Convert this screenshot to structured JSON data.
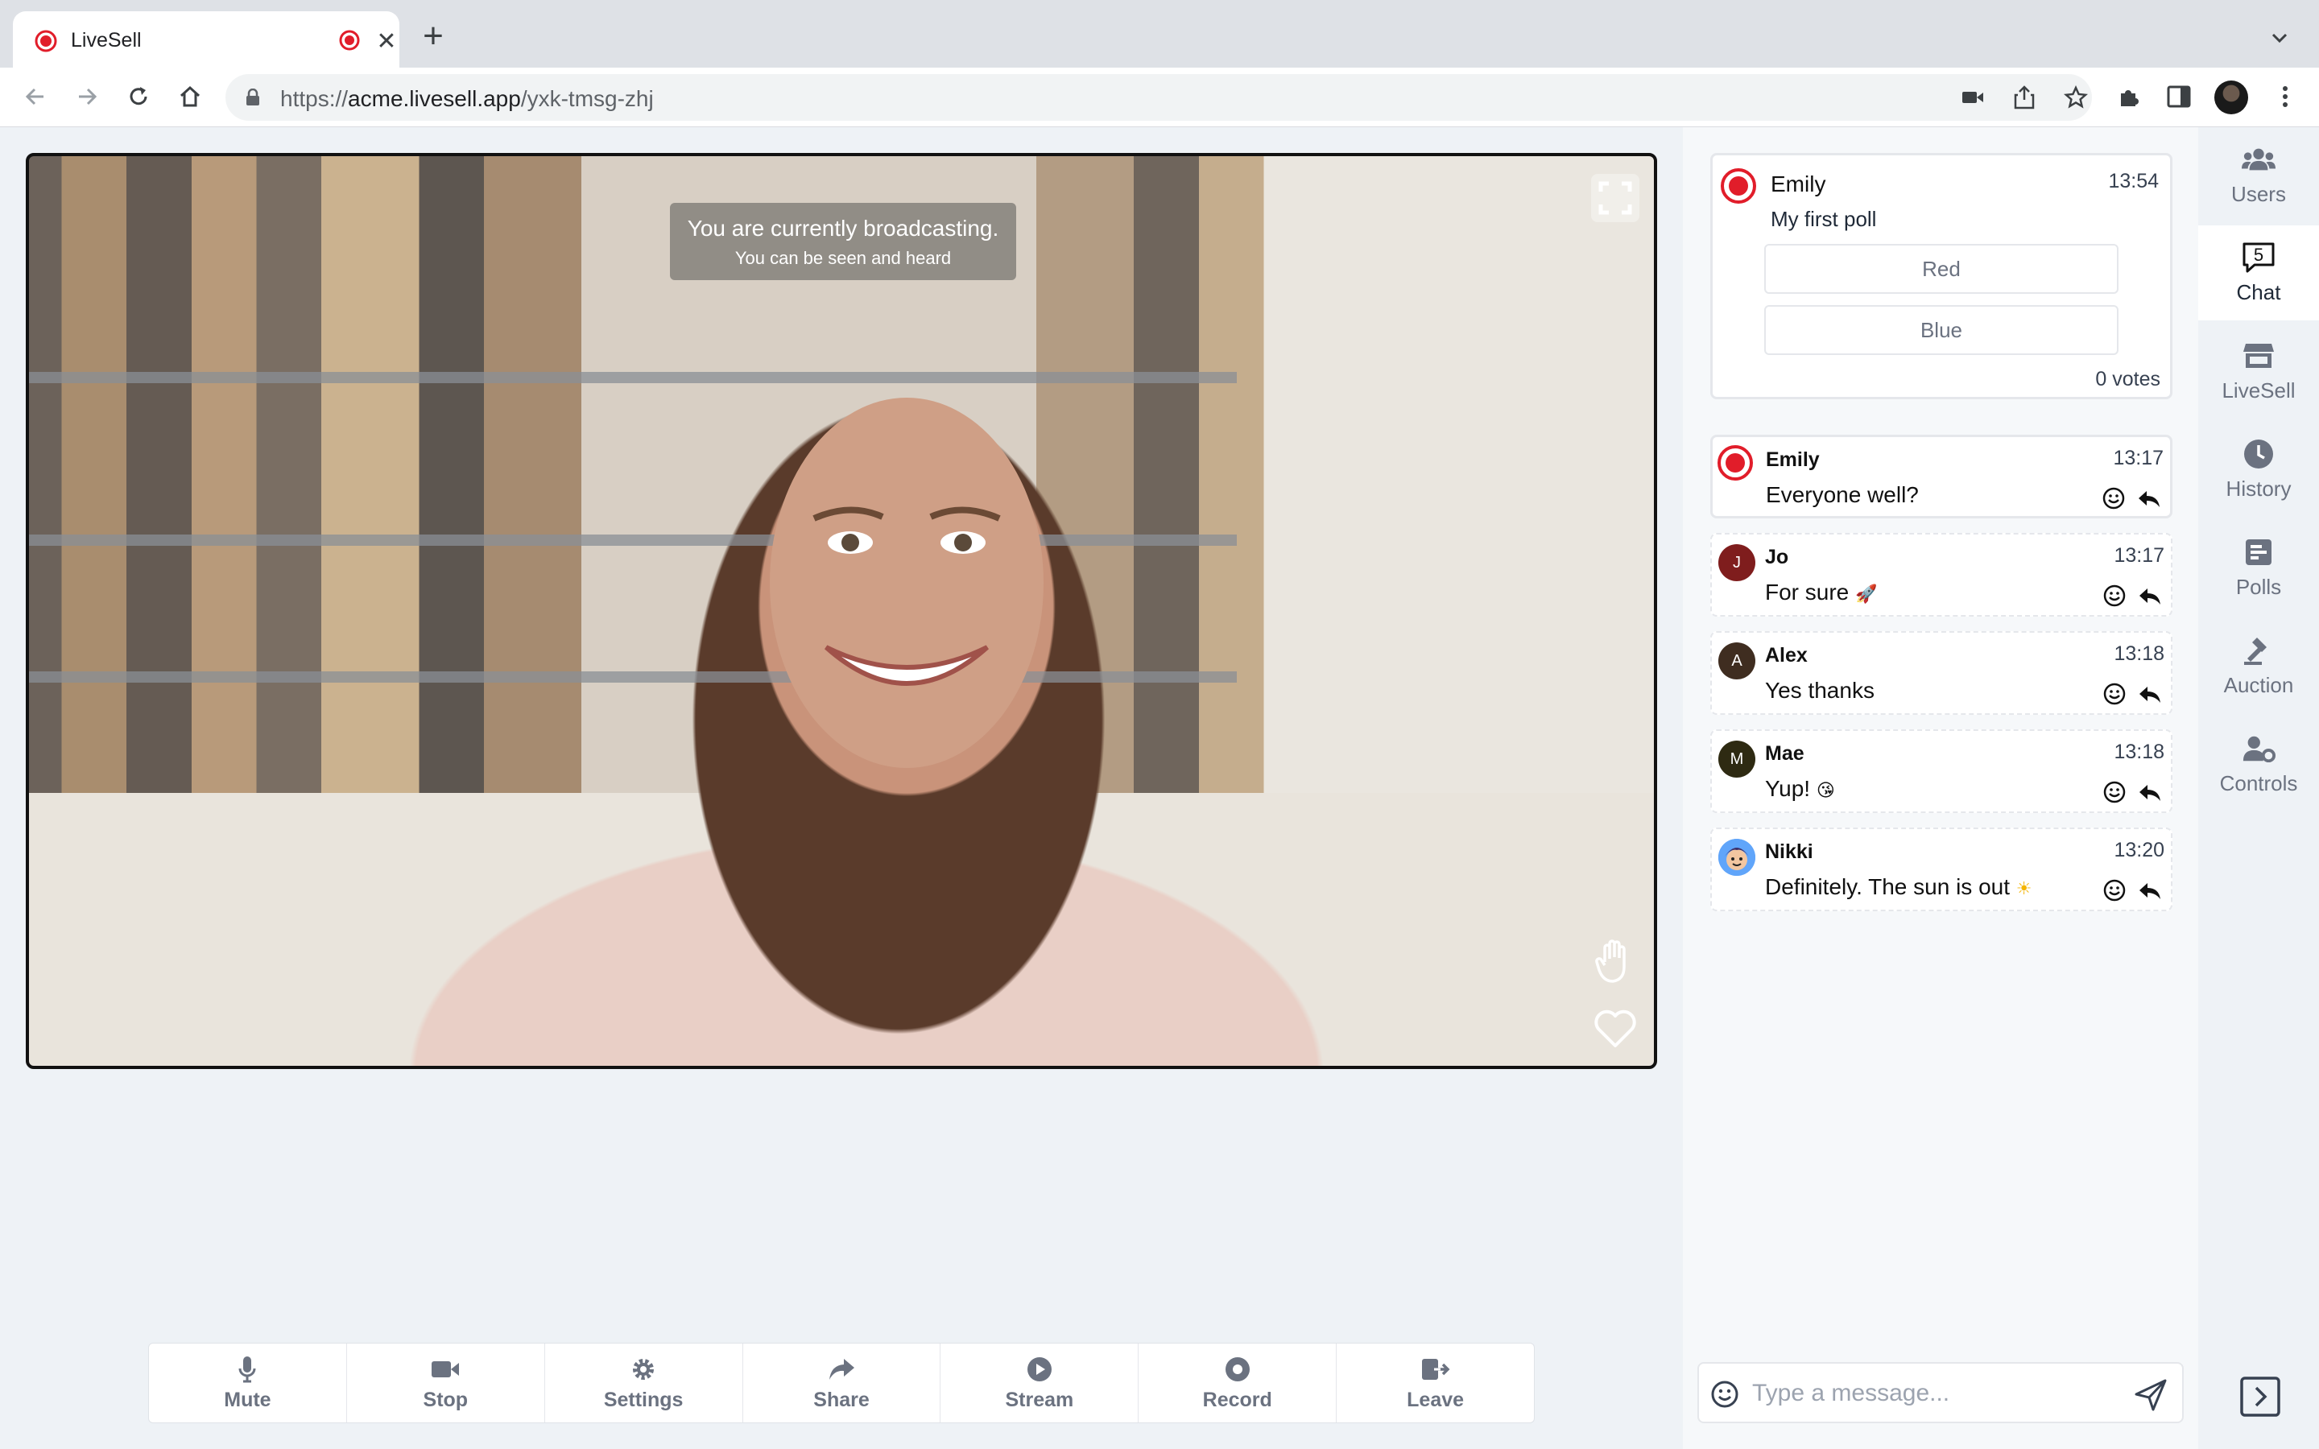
{
  "browser": {
    "tab_title": "LiveSell",
    "url_scheme": "https://",
    "url_host": "acme.livesell.app",
    "url_path": "/yxk-tmsg-zhj",
    "icons": [
      "back-icon",
      "forward-icon",
      "reload-icon",
      "home-icon",
      "lock-icon",
      "camera-icon",
      "share-icon",
      "star-icon",
      "extensions-icon",
      "sidebar-icon",
      "menu-icon"
    ]
  },
  "video": {
    "banner_title": "You are currently broadcasting.",
    "banner_subtitle": "You can be seen and heard"
  },
  "controls": [
    {
      "label": "Mute",
      "icon": "microphone-icon"
    },
    {
      "label": "Stop",
      "icon": "video-camera-icon"
    },
    {
      "label": "Settings",
      "icon": "gear-icon"
    },
    {
      "label": "Share",
      "icon": "share-arrow-icon"
    },
    {
      "label": "Stream",
      "icon": "play-circle-icon"
    },
    {
      "label": "Record",
      "icon": "record-icon"
    },
    {
      "label": "Leave",
      "icon": "leave-icon"
    }
  ],
  "poll": {
    "author": "Emily",
    "time": "13:54",
    "question": "My first poll",
    "options": [
      "Red",
      "Blue"
    ],
    "votes": "0 votes"
  },
  "messages": [
    {
      "name": "Emily",
      "time": "13:17",
      "text": "Everyone well?",
      "initial": "",
      "avatar_color": "#e11d2a"
    },
    {
      "name": "Jo",
      "time": "13:17",
      "text": "For sure",
      "emoji": "🚀",
      "initial": "J",
      "avatar_color": "#7f1d1d"
    },
    {
      "name": "Alex",
      "time": "13:18",
      "text": "Yes thanks",
      "initial": "A",
      "avatar_color": "#3f2d20"
    },
    {
      "name": "Mae",
      "time": "13:18",
      "text": "Yup!",
      "emoji": "😘",
      "initial": "M",
      "avatar_color": "#2e2a12"
    },
    {
      "name": "Nikki",
      "time": "13:20",
      "text": "Definitely. The sun is out",
      "emoji": "☀",
      "initial": "",
      "avatar_color": "#60a5fa"
    }
  ],
  "composer": {
    "placeholder": "Type a message..."
  },
  "sidebar": {
    "items": [
      {
        "label": "Users",
        "icon": "users-icon"
      },
      {
        "label": "Chat",
        "icon": "chat-icon",
        "badge": "5"
      },
      {
        "label": "LiveSell",
        "icon": "store-icon"
      },
      {
        "label": "History",
        "icon": "clock-icon"
      },
      {
        "label": "Polls",
        "icon": "poll-icon"
      },
      {
        "label": "Auction",
        "icon": "gavel-icon"
      },
      {
        "label": "Controls",
        "icon": "user-gear-icon"
      }
    ]
  },
  "colors": {
    "accent_red": "#e11d2a",
    "panel_bg": "#eef2f6",
    "muted_text": "#6b7280"
  }
}
